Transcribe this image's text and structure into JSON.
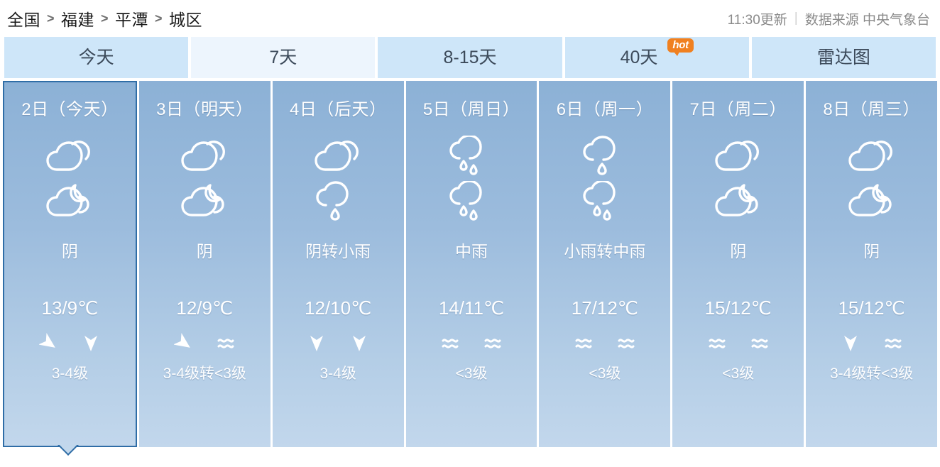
{
  "header": {
    "breadcrumb": [
      "全国",
      "福建",
      "平潭",
      "城区"
    ],
    "separator": ">",
    "update_time": "11:30更新",
    "divider": "|",
    "source": "数据来源 中央气象台"
  },
  "tabs": [
    {
      "label": "今天",
      "active": true,
      "shade": "dark",
      "badge": null
    },
    {
      "label": "7天",
      "active": false,
      "shade": "light",
      "badge": null
    },
    {
      "label": "8-15天",
      "active": false,
      "shade": "dark",
      "badge": null
    },
    {
      "label": "40天",
      "active": false,
      "shade": "dark",
      "badge": "hot"
    },
    {
      "label": "雷达图",
      "active": false,
      "shade": "dark",
      "badge": null
    }
  ],
  "days": [
    {
      "title": "2日（今天）",
      "selected": true,
      "day_icon": "cloudy-day-icon",
      "night_icon": "cloudy-night-icon",
      "condition": "阴",
      "temp": "13/9℃",
      "wind_day_icon": "wind-arrow-ne-icon",
      "wind_night_icon": "wind-arrow-down-icon",
      "wind_level": "3-4级"
    },
    {
      "title": "3日（明天）",
      "selected": false,
      "day_icon": "cloudy-day-icon",
      "night_icon": "cloudy-night-icon",
      "condition": "阴",
      "temp": "12/9℃",
      "wind_day_icon": "wind-arrow-ne-icon",
      "wind_night_icon": "wind-calm-icon",
      "wind_level": "3-4级转<3级"
    },
    {
      "title": "4日（后天）",
      "selected": false,
      "day_icon": "cloudy-day-icon",
      "night_icon": "light-rain-icon",
      "condition": "阴转小雨",
      "temp": "12/10℃",
      "wind_day_icon": "wind-arrow-down-icon",
      "wind_night_icon": "wind-arrow-down-icon",
      "wind_level": "3-4级"
    },
    {
      "title": "5日（周日）",
      "selected": false,
      "day_icon": "moderate-rain-icon",
      "night_icon": "moderate-rain-icon",
      "condition": "中雨",
      "temp": "14/11℃",
      "wind_day_icon": "wind-calm-icon",
      "wind_night_icon": "wind-calm-icon",
      "wind_level": "<3级"
    },
    {
      "title": "6日（周一）",
      "selected": false,
      "day_icon": "light-rain-icon",
      "night_icon": "moderate-rain-icon",
      "condition": "小雨转中雨",
      "temp": "17/12℃",
      "wind_day_icon": "wind-calm-icon",
      "wind_night_icon": "wind-calm-icon",
      "wind_level": "<3级"
    },
    {
      "title": "7日（周二）",
      "selected": false,
      "day_icon": "cloudy-day-icon",
      "night_icon": "cloudy-night-icon",
      "condition": "阴",
      "temp": "15/12℃",
      "wind_day_icon": "wind-calm-icon",
      "wind_night_icon": "wind-calm-icon",
      "wind_level": "<3级"
    },
    {
      "title": "8日（周三）",
      "selected": false,
      "day_icon": "cloudy-day-icon",
      "night_icon": "cloudy-night-icon",
      "condition": "阴",
      "temp": "15/12℃",
      "wind_day_icon": "wind-arrow-down-icon",
      "wind_night_icon": "wind-calm-icon",
      "wind_level": "3-4级转<3级"
    }
  ],
  "colors": {
    "tab_dark": "#cee6f9",
    "tab_light": "#edf5fd",
    "card_top": "#8cb1d6",
    "card_bottom": "#c2d7ec",
    "selected_border": "#2f6da6",
    "hot_badge": "#f08020",
    "text_primary": "#1a1a1a",
    "text_muted": "#8a8a8a"
  }
}
